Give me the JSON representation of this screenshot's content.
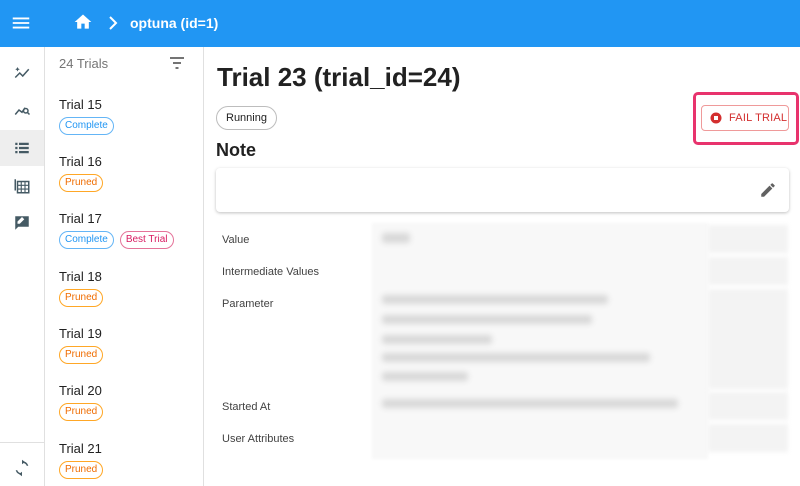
{
  "appbar": {
    "breadcrumb": "optuna (id=1)"
  },
  "sidebar": {
    "items": [
      {
        "icon": "auto-graph-icon",
        "active": false
      },
      {
        "icon": "query-stats-icon",
        "active": false
      },
      {
        "icon": "list-icon",
        "active": true
      },
      {
        "icon": "table-icon",
        "active": false
      },
      {
        "icon": "rate-review-icon",
        "active": false
      }
    ],
    "bottom_icon": "sync-icon"
  },
  "trial_list": {
    "header": "24 Trials",
    "items": [
      {
        "name": "Trial 15",
        "badges": [
          {
            "label": "Complete",
            "color": "#2196f3"
          }
        ]
      },
      {
        "name": "Trial 16",
        "badges": [
          {
            "label": "Pruned",
            "color": "#ef6c00"
          }
        ]
      },
      {
        "name": "Trial 17",
        "badges": [
          {
            "label": "Complete",
            "color": "#2196f3"
          },
          {
            "label": "Best Trial",
            "color": "#d81b60"
          }
        ]
      },
      {
        "name": "Trial 18",
        "badges": [
          {
            "label": "Pruned",
            "color": "#ef6c00"
          }
        ]
      },
      {
        "name": "Trial 19",
        "badges": [
          {
            "label": "Pruned",
            "color": "#ef6c00"
          }
        ]
      },
      {
        "name": "Trial 20",
        "badges": [
          {
            "label": "Pruned",
            "color": "#ef6c00"
          }
        ]
      },
      {
        "name": "Trial 21",
        "badges": [
          {
            "label": "Pruned",
            "color": "#ef6c00"
          }
        ]
      }
    ]
  },
  "main": {
    "title": "Trial 23 (trial_id=24)",
    "state": "Running",
    "fail_button": "FAIL TRIAL",
    "note_heading": "Note",
    "rows": [
      {
        "label": "Value"
      },
      {
        "label": "Intermediate Values"
      },
      {
        "label": "Parameter"
      },
      {
        "label": "Started At"
      },
      {
        "label": "User Attributes"
      }
    ]
  },
  "colors": {
    "appbar": "#2196f3",
    "highlight": "#e8336d",
    "danger": "#d32f2f"
  }
}
